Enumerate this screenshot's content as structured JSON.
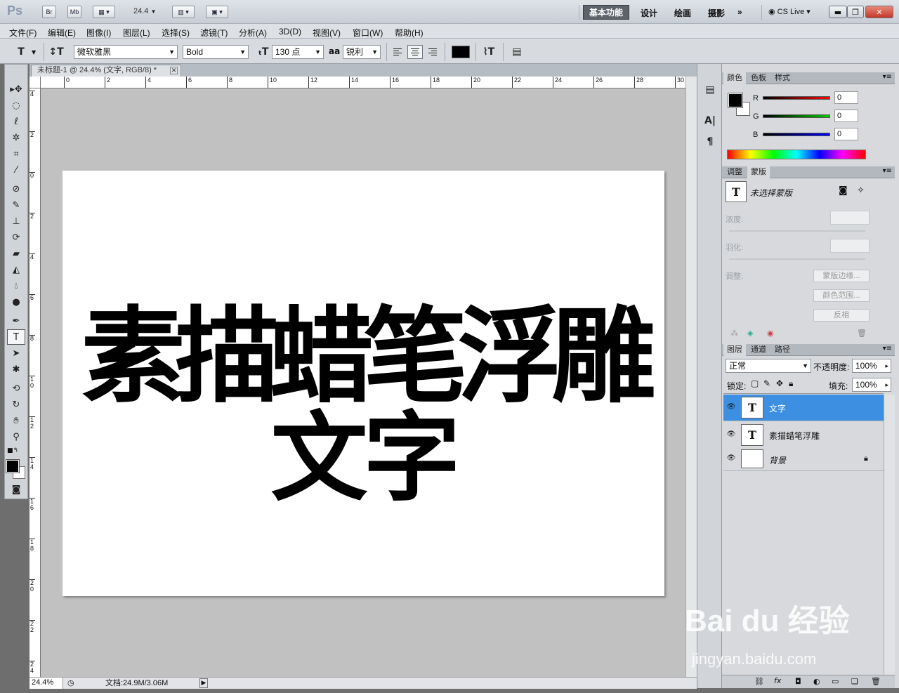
{
  "app": {
    "logo": "Ps",
    "bridge": "Br",
    "minibridge": "Mb",
    "zoom": "24.4"
  },
  "workspaces": {
    "active": "基本功能",
    "items": [
      "设计",
      "绘画",
      "摄影"
    ],
    "more": "»"
  },
  "cslive": "CS Live",
  "menu": [
    "文件(F)",
    "编辑(E)",
    "图像(I)",
    "图层(L)",
    "选择(S)",
    "滤镜(T)",
    "分析(A)",
    "3D(D)",
    "视图(V)",
    "窗口(W)",
    "帮助(H)"
  ],
  "options": {
    "tool_icon": "T",
    "font_family": "微软雅黑",
    "font_style": "Bold",
    "font_size": "130 点",
    "aa_label": "aa",
    "aa_mode": "锐利",
    "text_color": "#000000"
  },
  "document": {
    "tab_title": "未标题-1 @ 24.4% (文字, RGB/8) *",
    "line1": "素描蜡笔浮雕",
    "line2": "文字"
  },
  "ruler": {
    "h_ticks": [
      "0",
      "2",
      "4",
      "6",
      "8",
      "10",
      "12",
      "14",
      "16",
      "18",
      "20",
      "22",
      "24",
      "26",
      "28",
      "30"
    ],
    "v_ticks": [
      "4",
      "2",
      "0",
      "2",
      "4",
      "6",
      "8",
      "1 0",
      "1 2",
      "1 4",
      "1 6",
      "1 8",
      "2 0",
      "2 2",
      "2 4"
    ]
  },
  "status": {
    "zoom": "24.4%",
    "doc_size": "文档:24.9M/3.06M"
  },
  "color_panel": {
    "tabs": [
      "颜色",
      "色板",
      "样式"
    ],
    "r_label": "R",
    "g_label": "G",
    "b_label": "B",
    "r": "0",
    "g": "0",
    "b": "0"
  },
  "masks_panel": {
    "tabs": [
      "调整",
      "蒙版"
    ],
    "no_mask": "未选择蒙版",
    "density": "浓度:",
    "feather": "羽化:",
    "refine": "调整:",
    "btn_edge": "蒙版边缘...",
    "btn_range": "颜色范围...",
    "btn_invert": "反相"
  },
  "layers_panel": {
    "tabs": [
      "图层",
      "通道",
      "路径"
    ],
    "blend": "正常",
    "opacity_label": "不透明度:",
    "opacity": "100%",
    "lock_label": "锁定:",
    "fill_label": "填充:",
    "fill": "100%",
    "layers": [
      {
        "name": "文字",
        "thumb": "T"
      },
      {
        "name": "素描蜡笔浮雕",
        "thumb": "T"
      },
      {
        "name": "背景",
        "thumb": ""
      }
    ]
  },
  "watermark": {
    "brand": "Bai du 经验",
    "url": "jingyan.baidu.com"
  }
}
